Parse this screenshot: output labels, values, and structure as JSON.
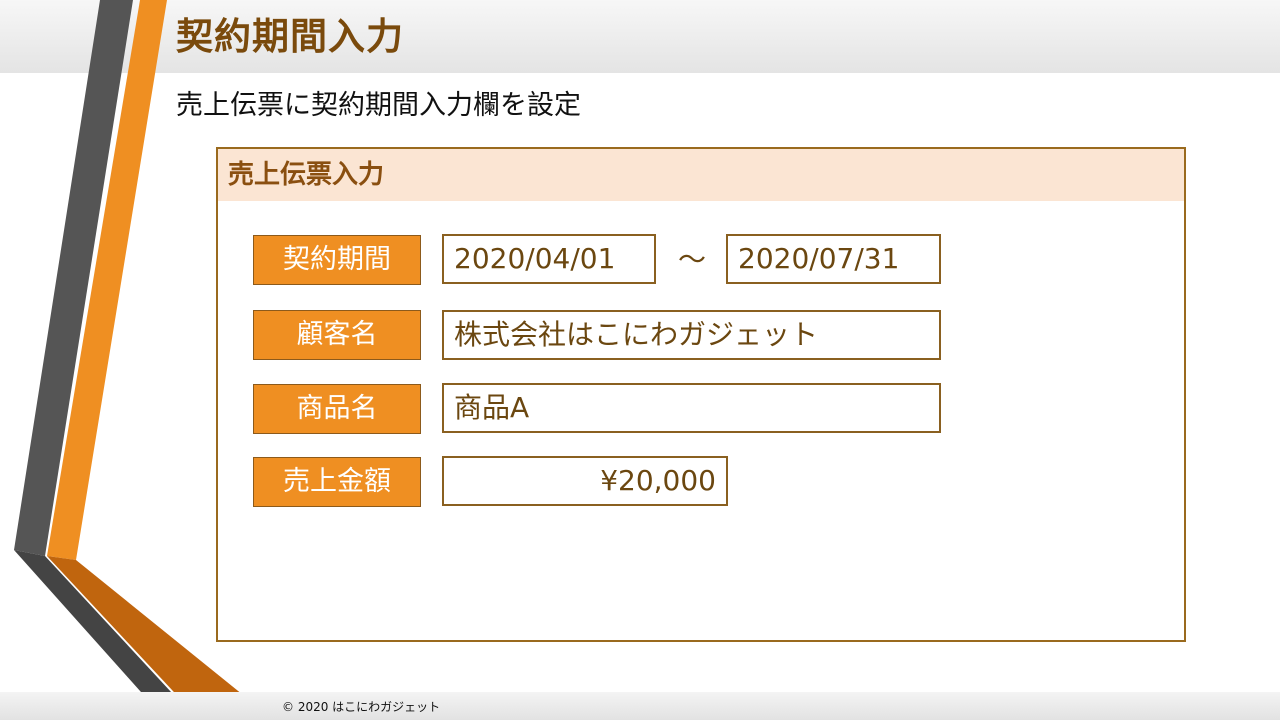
{
  "slide": {
    "title": "契約期間入力",
    "subtitle": "売上伝票に契約期間入力欄を設定"
  },
  "form": {
    "title": "売上伝票入力",
    "fields": [
      {
        "label": "契約期間",
        "value_start": "2020/04/01",
        "separator": "～",
        "value_end": "2020/07/31"
      },
      {
        "label": "顧客名",
        "value": "株式会社はこにわガジェット"
      },
      {
        "label": "商品名",
        "value": "商品A"
      },
      {
        "label": "売上金額",
        "value": "¥20,000"
      }
    ]
  },
  "footer": {
    "copyright": "© 2020 はこにわガジェット"
  },
  "colors": {
    "accent_orange": "#ef8f22",
    "title_brown": "#7a4a0c",
    "panel_border": "#9a6a1e",
    "panel_header_bg": "#fbe5d3",
    "deco_gray": "#4d4d4d"
  }
}
